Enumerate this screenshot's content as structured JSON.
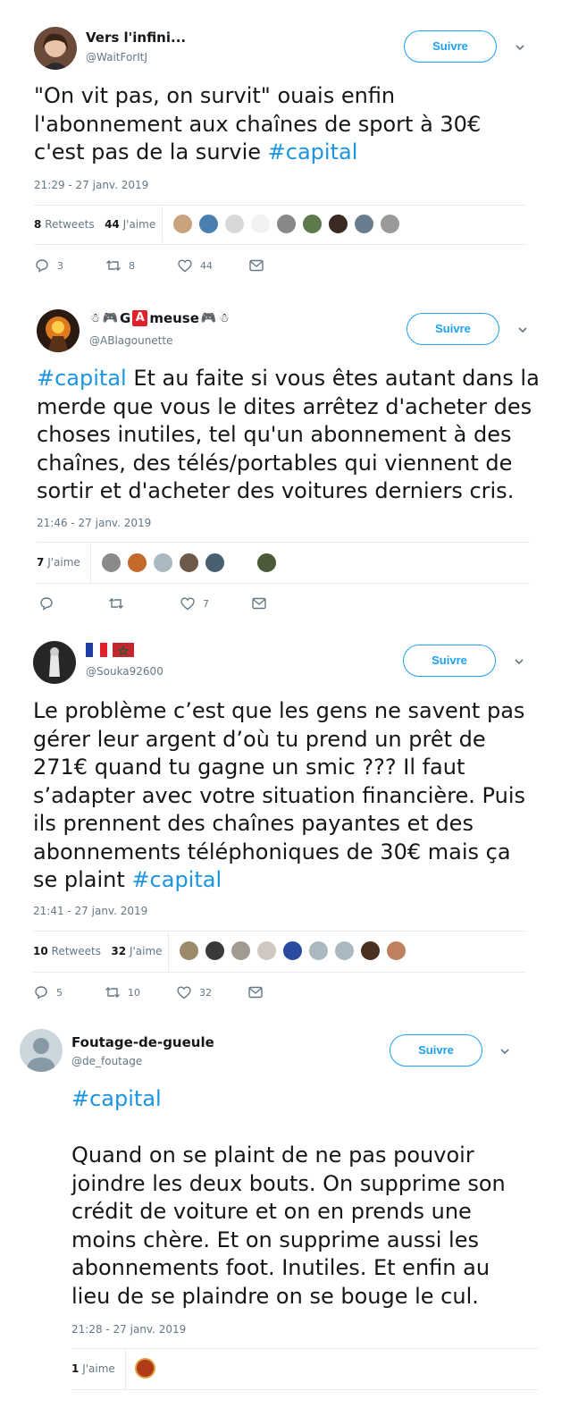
{
  "tweets": [
    {
      "name": "Vers l'infini...",
      "handle": "@WaitForItJ",
      "follow_label": "Suivre",
      "text_lines": [
        "\"On vit pas, on survit\" ouais enfin",
        "l'abonnement aux chaînes de sport à 30€",
        "c'est pas de la survie "
      ],
      "hashtag": "#capital",
      "date": "21:29 - 27 janv. 2019",
      "retweets_count": "8",
      "retweets_label": "Retweets",
      "likes_count": "44",
      "likes_label": "J'aime",
      "reply_count": "3",
      "retweet_action_count": "8",
      "like_action_count": "44"
    },
    {
      "name_parts": [
        "G",
        "A",
        "meuse"
      ],
      "handle": "@ABlagounette",
      "follow_label": "Suivre",
      "text_lines": [
        "Et au faite si vous êtes autant dans la",
        "merde que vous le dites arrêtez d'acheter des",
        "choses inutiles, tel qu'un abonnement à des",
        "chaînes, des télés/portables qui viennent de",
        "sortir et d'acheter des voitures derniers cris."
      ],
      "hashtag": "#capital",
      "date": "21:46 - 27 janv. 2019",
      "likes_count": "7",
      "likes_label": "J'aime",
      "like_action_count": "7"
    },
    {
      "handle": "@Souka92600",
      "follow_label": "Suivre",
      "text_lines": [
        "Le problème c’est que les gens ne savent pas",
        "gérer leur argent d’où tu prend un prêt de",
        "271€ quand tu gagne un smic ??? Il faut",
        "s’adapter avec votre situation financière. Puis",
        "ils prennent des chaînes payantes et des",
        "abonnements téléphoniques de 30€ mais ça",
        "se plaint "
      ],
      "hashtag": "#capital",
      "date": "21:41 - 27 janv. 2019",
      "retweets_count": "10",
      "retweets_label": "Retweets",
      "likes_count": "32",
      "likes_label": "J'aime",
      "reply_count": "5",
      "retweet_action_count": "10",
      "like_action_count": "32"
    },
    {
      "name": "Foutage-de-gueule",
      "handle": "@de_foutage",
      "follow_label": "Suivre",
      "hashtag": "#capital",
      "text_lines": [
        "Quand on se plaint de ne pas pouvoir",
        "joindre les deux bouts. On supprime son",
        "crédit de voiture et on en prends une",
        "moins chère.  Et on supprime aussi les",
        "abonnements foot.  Inutiles. Et enfin au",
        "lieu de se plaindre on se bouge le cul."
      ],
      "date": "21:28 - 27 janv. 2019",
      "likes_count": "1",
      "likes_label": "J'aime"
    }
  ],
  "colors": {
    "accent": "#1da1f2",
    "hashtag": "#1b95e0",
    "secondary_text": "#657786",
    "border": "#e6ecf0"
  },
  "icons": [
    "reply-icon",
    "retweet-icon",
    "like-icon",
    "message-icon",
    "chevron-down-icon"
  ]
}
